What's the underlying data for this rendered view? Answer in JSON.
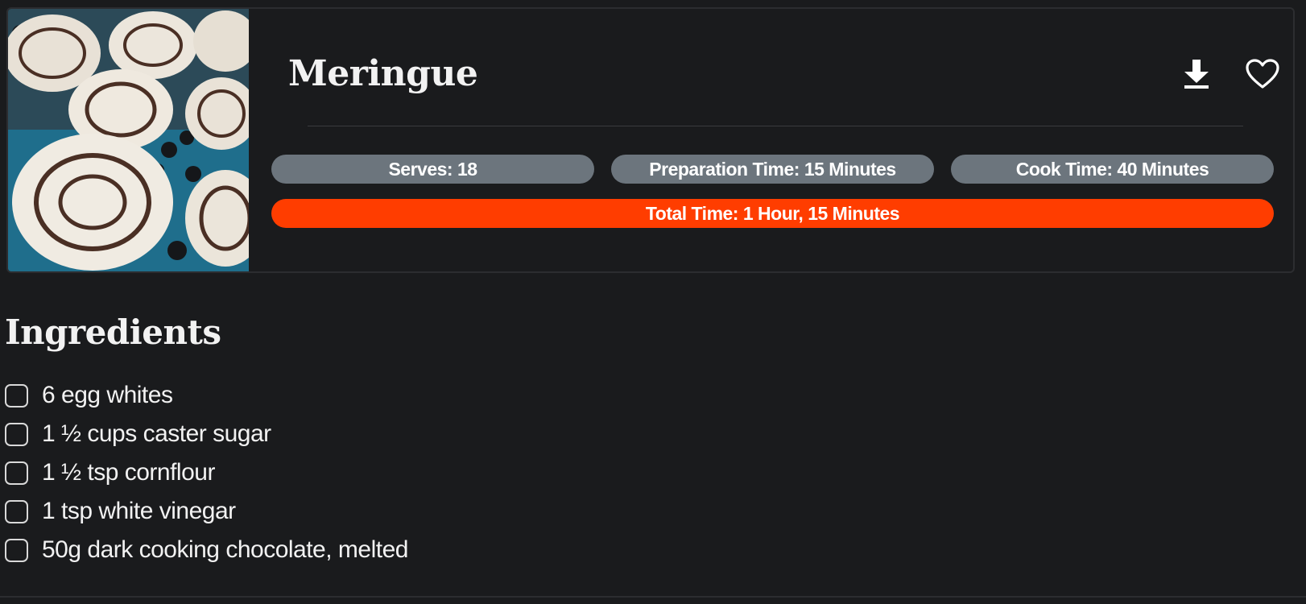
{
  "recipe": {
    "title": "Meringue",
    "image_alt": "Meringue",
    "actions": {
      "download_icon": "download-icon",
      "favorite_icon": "heart-outline-icon"
    },
    "stats": {
      "serves": "Serves: 18",
      "prep_time": "Preparation Time: 15 Minutes",
      "cook_time": "Cook Time: 40 Minutes",
      "total_time": "Total Time: 1 Hour, 15 Minutes"
    }
  },
  "ingredients": {
    "heading": "Ingredients",
    "items": [
      "6 egg whites",
      "1 ½ cups caster sugar",
      "1 ½ tsp cornflour",
      "1 tsp white vinegar",
      "50g dark cooking chocolate, melted"
    ]
  },
  "colors": {
    "background": "#1a1b1d",
    "pill_gray": "#6c757d",
    "pill_accent": "#ff3d00",
    "text": "#f2f2f2"
  }
}
